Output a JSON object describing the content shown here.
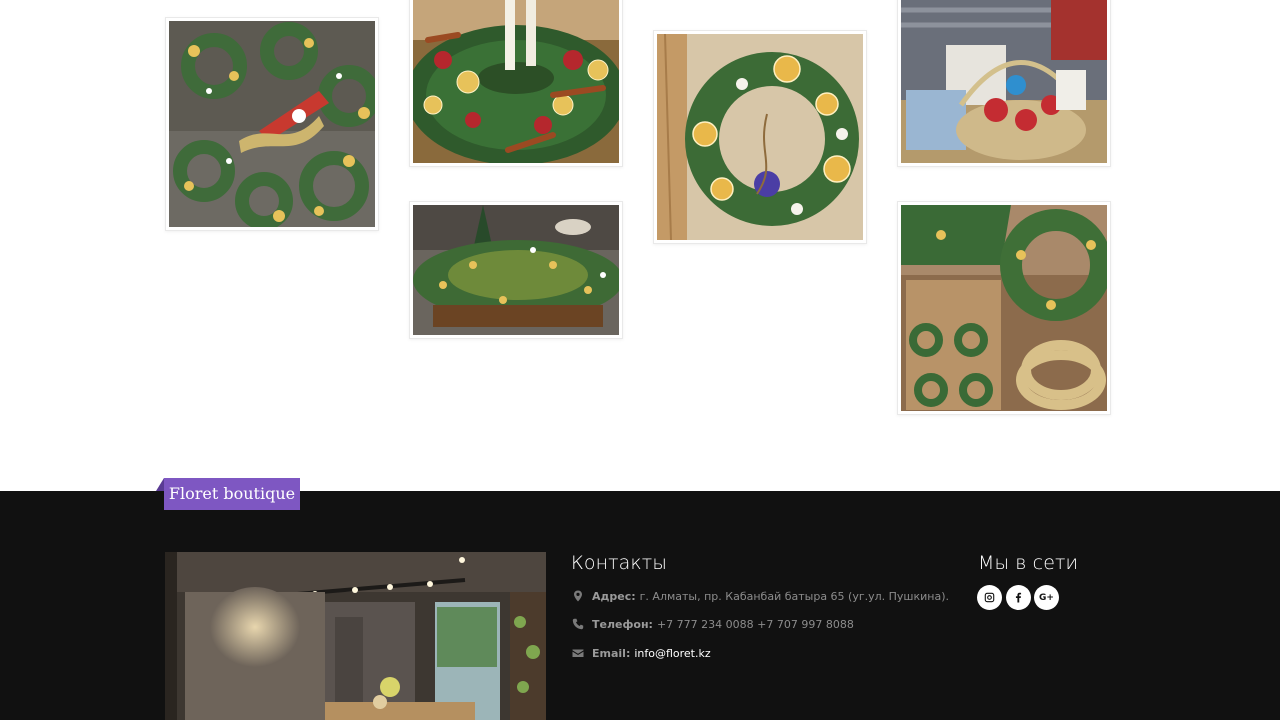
{
  "gallery": {
    "images": [
      {
        "alt": "advent-wreaths-table"
      },
      {
        "alt": "wreath-with-candles"
      },
      {
        "alt": "wreaths-on-table"
      },
      {
        "alt": "wreath-with-oranges-logo"
      },
      {
        "alt": "gift-basket"
      },
      {
        "alt": "wreaths-on-stand"
      }
    ]
  },
  "footer": {
    "brand": "Floret boutique",
    "contacts": {
      "title": "Контакты",
      "address_label": "Адрес:",
      "address_value": "г. Алматы, пр. Кабанбай батыра 65 (уг.ул. Пушкина).",
      "phone_label": "Телефон:",
      "phone_value": "+7 777 234 0088 +7 707 997 8088",
      "email_label": "Email:",
      "email_value": "info@floret.kz"
    },
    "social": {
      "title": "Мы в сети",
      "items": [
        {
          "icon": "instagram-icon"
        },
        {
          "icon": "facebook-icon"
        },
        {
          "icon": "google-plus-icon",
          "glyph": "G+"
        }
      ]
    }
  },
  "colors": {
    "accent": "#7e57c2",
    "footer_bg": "#111111",
    "text_muted": "#8c8c8c"
  }
}
